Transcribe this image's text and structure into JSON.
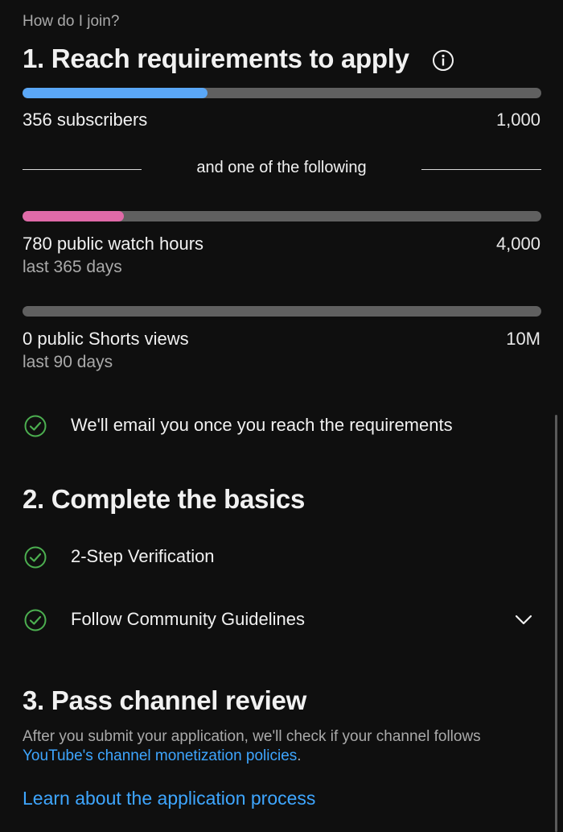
{
  "intro": "How do I join?",
  "section1": {
    "title": "1. Reach requirements to apply",
    "subscribers": {
      "label": "356 subscribers",
      "target": "1,000",
      "progress": 0.356,
      "color": "#5aa7f7"
    },
    "divider": "and one of the following",
    "watch_hours": {
      "label": "780 public watch hours",
      "sub": "last 365 days",
      "target": "4,000",
      "progress": 0.195,
      "color": "#e06aa8"
    },
    "shorts": {
      "label": "0 public Shorts views",
      "sub": "last 90 days",
      "target": "10M",
      "progress": 0
    },
    "email_note": "We'll email you once you reach the requirements"
  },
  "section2": {
    "title": "2. Complete the basics",
    "items": [
      {
        "label": "2-Step Verification"
      },
      {
        "label": "Follow Community Guidelines"
      }
    ]
  },
  "section3": {
    "title": "3. Pass channel review",
    "desc_prefix": "After you submit your application, we'll check if your channel follows ",
    "desc_link": "YouTube's channel monetization policies",
    "desc_suffix": ".",
    "learn_link": "Learn about the application process"
  },
  "icons": {
    "info": "info-icon",
    "check": "check-circle-icon",
    "chevron": "chevron-down-icon"
  },
  "colors": {
    "background": "#0f0f0f",
    "link": "#3ea6ff",
    "check": "#4caf50",
    "track": "#606060"
  }
}
